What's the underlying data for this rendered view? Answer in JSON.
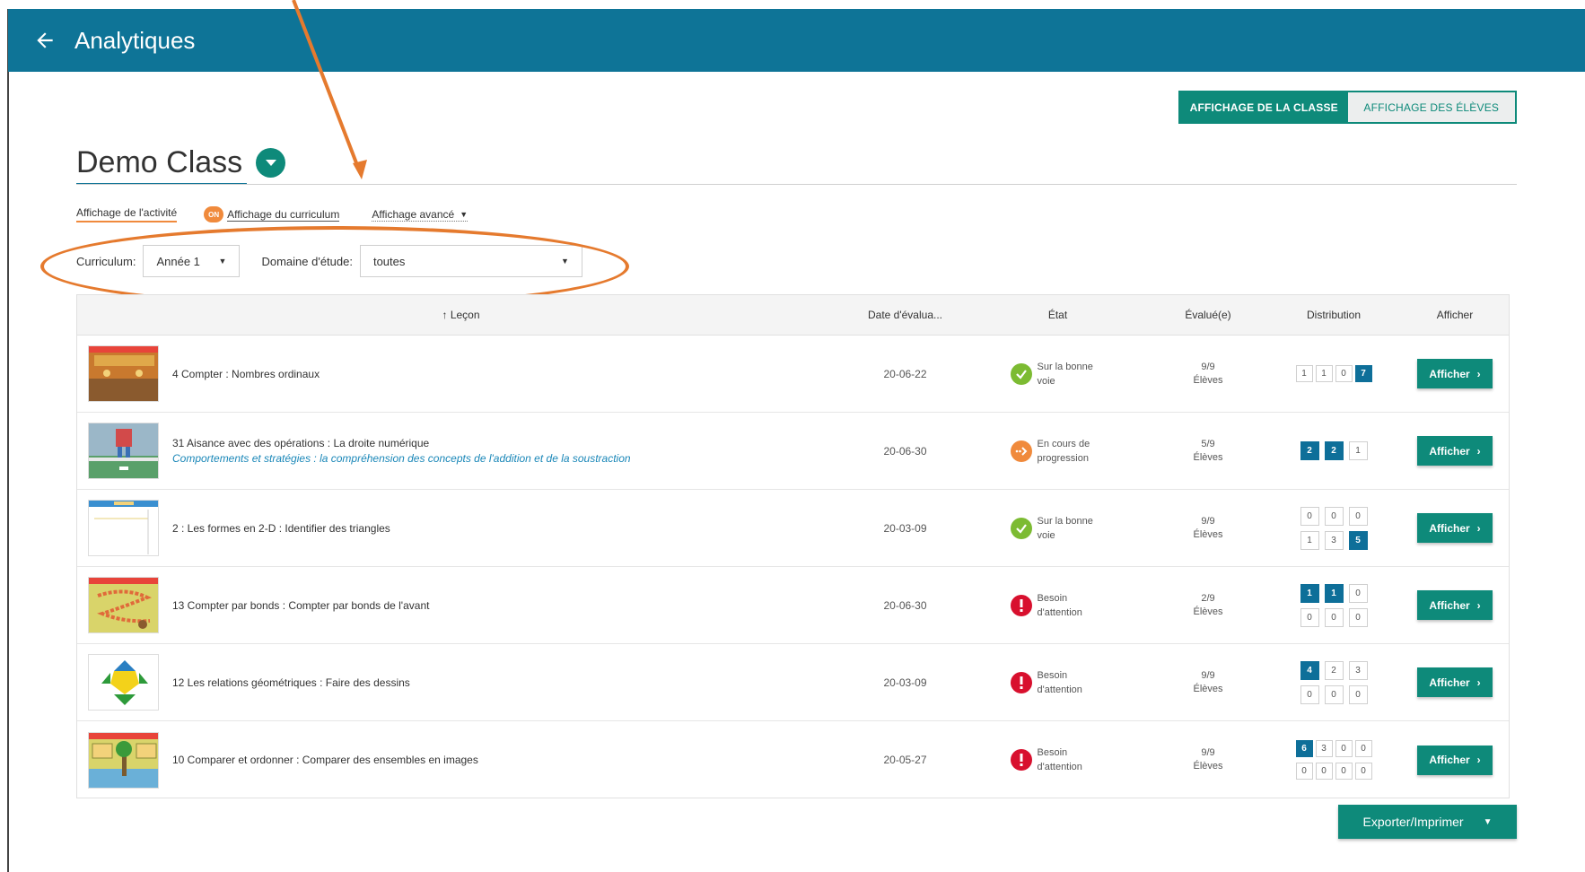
{
  "appbar": {
    "title": "Analytiques"
  },
  "view_toggle": {
    "class_view": "AFFICHAGE DE LA CLASSE",
    "student_view": "AFFICHAGE DES ÉLÈVES"
  },
  "class": {
    "name": "Demo Class"
  },
  "tabs": {
    "activity": "Affichage de l'activité",
    "on_badge": "ON",
    "curriculum": "Affichage du curriculum",
    "advanced": "Affichage avancé"
  },
  "filters": {
    "curriculum_label": "Curriculum:",
    "curriculum_value": "Année 1",
    "domain_label": "Domaine d'étude:",
    "domain_value": "toutes"
  },
  "table": {
    "headers": {
      "lesson": "↑ Leçon",
      "date": "Date d'évalua...",
      "state": "État",
      "evaluated": "Évalué(e)",
      "distribution": "Distribution",
      "view": "Afficher"
    },
    "rows": [
      {
        "lesson": "4 Compter : Nombres ordinaux",
        "sub": "",
        "date": "20-06-22",
        "state": "Sur la bonne voie",
        "eval": "9/9",
        "eval_unit": "Élèves",
        "dist_top": [
          "1",
          "1",
          "0",
          "7"
        ],
        "dist_bottom": []
      },
      {
        "lesson": "31 Aisance avec des opérations : La droite numérique",
        "sub": "Comportements et stratégies : la compréhension des concepts de l'addition et de la soustraction",
        "date": "20-06-30",
        "state": "En cours de progression",
        "eval": "5/9",
        "eval_unit": "Élèves",
        "dist_top": [
          "2",
          "2",
          "1"
        ],
        "dist_bottom": []
      },
      {
        "lesson": "2 : Les formes en 2-D : Identifier des triangles",
        "sub": "",
        "date": "20-03-09",
        "state": "Sur la bonne voie",
        "eval": "9/9",
        "eval_unit": "Élèves",
        "dist_top": [
          "0",
          "0",
          "0"
        ],
        "dist_bottom": [
          "1",
          "3",
          "5"
        ]
      },
      {
        "lesson": "13 Compter par bonds : Compter par bonds de l'avant",
        "sub": "",
        "date": "20-06-30",
        "state": "Besoin d'attention",
        "eval": "2/9",
        "eval_unit": "Élèves",
        "dist_top": [
          "1",
          "1",
          "0"
        ],
        "dist_bottom": [
          "0",
          "0",
          "0"
        ]
      },
      {
        "lesson": "12 Les relations géométriques : Faire des dessins",
        "sub": "",
        "date": "20-03-09",
        "state": "Besoin d'attention",
        "eval": "9/9",
        "eval_unit": "Élèves",
        "dist_top": [
          "4",
          "2",
          "3"
        ],
        "dist_bottom": [
          "0",
          "0",
          "0"
        ]
      },
      {
        "lesson": "10 Comparer et ordonner : Comparer des ensembles en images",
        "sub": "",
        "date": "20-05-27",
        "state": "Besoin d'attention",
        "eval": "9/9",
        "eval_unit": "Élèves",
        "dist_top": [
          "6",
          "3",
          "0",
          "0"
        ],
        "dist_bottom": [
          "0",
          "0",
          "0",
          "0"
        ]
      }
    ],
    "view_label": "Afficher"
  },
  "export": {
    "label": "Exporter/Imprimer"
  },
  "icons": {
    "back": "arrow-left-icon",
    "class_dropdown": "chevron-down-circle-icon",
    "state_ok": "check-circle-icon",
    "state_progress": "arrow-circle-icon",
    "state_attention": "exclamation-circle-icon",
    "view_chevron": "chevron-right-icon",
    "export_caret": "caret-down-icon"
  },
  "colors": {
    "appbar": "#0e7497",
    "primary_button": "#0e8a7a",
    "accent_orange": "#f08a3c",
    "highlight_box": "#0e6f99",
    "state_ok": "#7cbb32",
    "state_attention": "#d8102e",
    "annotation": "#e57a2e"
  }
}
